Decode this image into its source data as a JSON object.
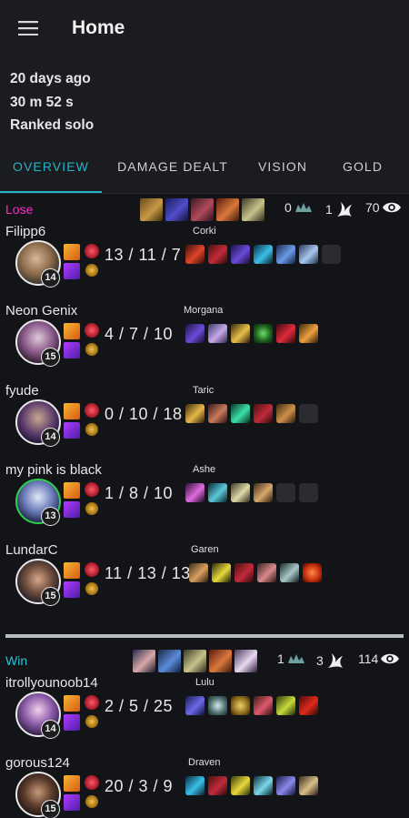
{
  "appbar": {
    "title": "Home",
    "menu_icon": "hamburger-menu-icon"
  },
  "meta": {
    "time_ago": "20 days ago",
    "duration": "30 m 52 s",
    "queue": "Ranked solo"
  },
  "tabs": [
    {
      "label": "OVERVIEW",
      "active": true
    },
    {
      "label": "DAMAGE DEALT",
      "active": false
    },
    {
      "label": "VISION",
      "active": false
    },
    {
      "label": "GOLD",
      "active": false
    }
  ],
  "colors": {
    "accent": "#22b4c9",
    "lose": "#ff2bc8",
    "win": "#22c3d6",
    "background": "#121418",
    "surface": "#1b1c1f"
  },
  "teams": [
    {
      "result": "Lose",
      "towers": "0",
      "dragons": "1",
      "wards": "70",
      "players": [
        {
          "name": "Filipp6",
          "champion": "Corki",
          "level": "14",
          "kda": "13 / 11 / 7",
          "empty_slots": 1
        },
        {
          "name": "Neon Genix",
          "champion": "Morgana",
          "level": "15",
          "kda": "4 / 7 / 10",
          "empty_slots": 0
        },
        {
          "name": "fyude",
          "champion": "Taric",
          "level": "14",
          "kda": "0 / 10 / 18",
          "empty_slots": 1
        },
        {
          "name": "my pink is black",
          "champion": "Ashe",
          "level": "13",
          "kda": "1 / 8 / 10",
          "empty_slots": 2
        },
        {
          "name": "LundarC",
          "champion": "Garen",
          "level": "15",
          "kda": "11 / 13 / 13",
          "empty_slots": 0
        }
      ]
    },
    {
      "result": "Win",
      "towers": "1",
      "dragons": "3",
      "wards": "114",
      "players": [
        {
          "name": "itrollyounoob14",
          "champion": "Lulu",
          "level": "14",
          "kda": "2 / 5 / 25",
          "empty_slots": 0
        },
        {
          "name": "gorous124",
          "champion": "Draven",
          "level": "15",
          "kda": "20 / 3 / 9",
          "empty_slots": 0
        }
      ]
    }
  ]
}
